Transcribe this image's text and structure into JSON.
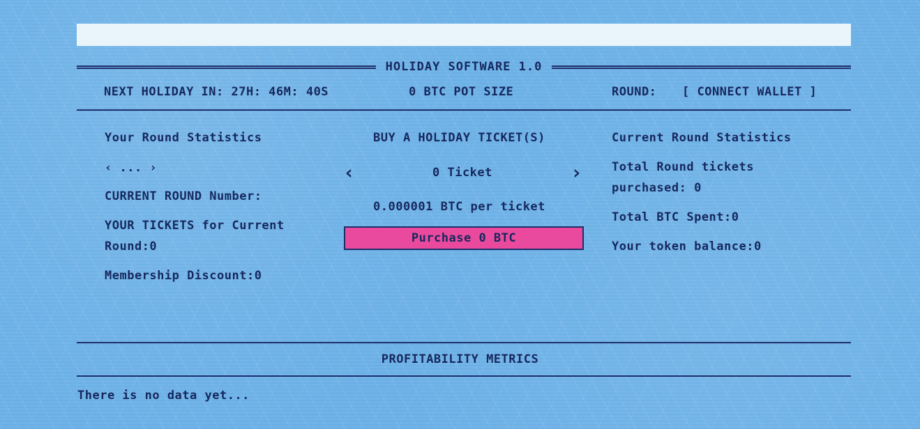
{
  "app": {
    "title": "HOLIDAY SOFTWARE 1.0"
  },
  "header": {
    "countdown_label": "NEXT HOLIDAY IN: 27H: 46M: 40S",
    "pot_size": "0 BTC POT SIZE",
    "round_label": "ROUND:",
    "connect_wallet": "[ CONNECT WALLET ]"
  },
  "your_stats": {
    "heading": "Your Round Statistics",
    "pager": "‹ ... ›",
    "current_round_number": "CURRENT ROUND Number:",
    "your_tickets_line1": "YOUR TICKETS for Current",
    "your_tickets_line2": "Round:0",
    "membership_discount": "Membership Discount:0"
  },
  "buy": {
    "heading": "BUY A HOLIDAY TICKET(S)",
    "prev_icon": "‹",
    "next_icon": "›",
    "ticket_count": "0 Ticket",
    "price_per_ticket": "0.000001 BTC per ticket",
    "purchase_label": "Purchase 0 BTC"
  },
  "round_stats": {
    "heading": "Current Round Statistics",
    "total_tickets_line1": "Total Round tickets",
    "total_tickets_line2": "purchased: 0",
    "total_btc_spent": "Total BTC Spent:0",
    "token_balance": "Your token balance:0"
  },
  "profitability": {
    "heading": "PROFITABILITY METRICS",
    "empty_message": "There is no data yet..."
  },
  "colors": {
    "background": "#6fb3e8",
    "text": "#16285e",
    "accent_button": "#ea4a9d",
    "topbar": "#e9f4fb"
  }
}
